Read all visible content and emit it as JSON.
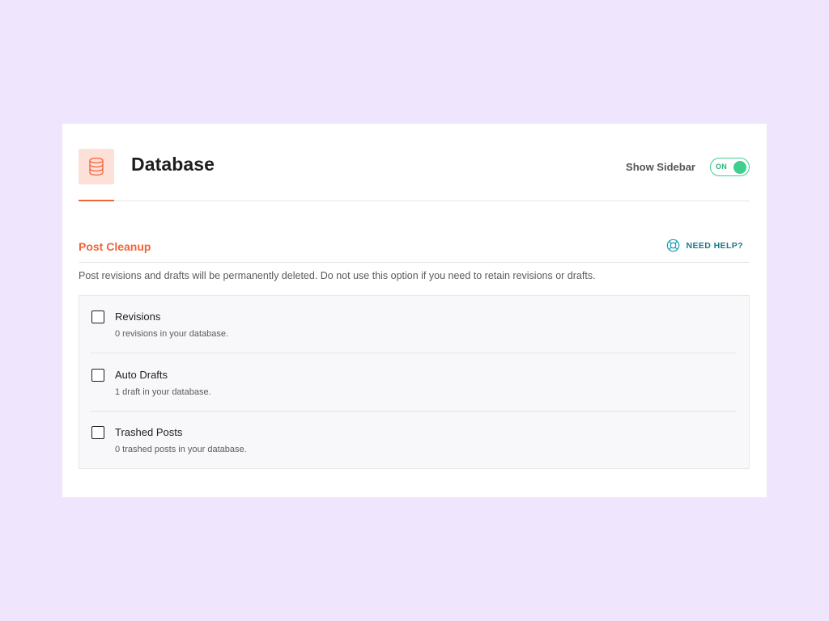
{
  "header": {
    "title": "Database",
    "icon": "database-icon",
    "accent_color": "#f0643a"
  },
  "sidebar_toggle": {
    "label": "Show Sidebar",
    "state_label": "ON",
    "is_on": true,
    "color": "#3ecf8e"
  },
  "section": {
    "title": "Post Cleanup",
    "help_label": "NEED HELP?",
    "help_icon": "lifebuoy-icon",
    "description": "Post revisions and drafts will be permanently deleted. Do not use this option if you need to retain revisions or drafts."
  },
  "options": [
    {
      "label": "Revisions",
      "description": "0 revisions in your database.",
      "checked": false
    },
    {
      "label": "Auto Drafts",
      "description": "1 draft in your database.",
      "checked": false
    },
    {
      "label": "Trashed Posts",
      "description": "0 trashed posts in your database.",
      "checked": false
    }
  ]
}
